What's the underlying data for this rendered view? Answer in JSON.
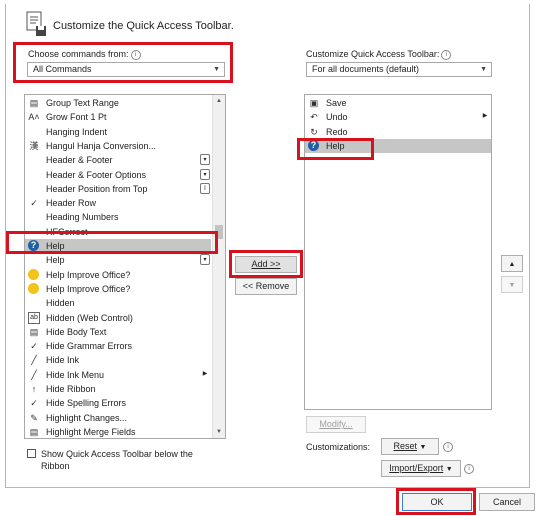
{
  "header": {
    "title": "Customize the Quick Access Toolbar."
  },
  "left": {
    "choose_label": "Choose commands from:",
    "choose_value": "All Commands",
    "items": [
      {
        "label": "Group Text Range",
        "icon": "group-text-icon",
        "glyph": "▤"
      },
      {
        "label": "Grow Font 1 Pt",
        "icon": "grow-font-icon",
        "glyph": "A˄"
      },
      {
        "label": "Hanging Indent",
        "icon": "",
        "glyph": ""
      },
      {
        "label": "Hangul Hanja Conversion...",
        "icon": "hanja-icon",
        "glyph": "漢"
      },
      {
        "label": "Header & Footer",
        "icon": "",
        "glyph": "",
        "side": "▾"
      },
      {
        "label": "Header & Footer Options",
        "icon": "",
        "glyph": "",
        "side": "▾"
      },
      {
        "label": "Header Position from Top",
        "icon": "",
        "glyph": "",
        "side": "I"
      },
      {
        "label": "Header Row",
        "icon": "check-icon",
        "glyph": "✓"
      },
      {
        "label": "Heading Numbers",
        "icon": "",
        "glyph": ""
      },
      {
        "label": "HFCorrect",
        "icon": "",
        "glyph": ""
      },
      {
        "label": "Help",
        "icon": "help-icon",
        "glyph": "?",
        "selected": true
      },
      {
        "label": "Help",
        "icon": "",
        "glyph": "",
        "side": "▾"
      },
      {
        "label": "Help Improve Office?",
        "icon": "smiley-icon",
        "glyph": "smile"
      },
      {
        "label": "Help Improve Office?",
        "icon": "smiley-icon",
        "glyph": "smile"
      },
      {
        "label": "Hidden",
        "icon": "",
        "glyph": ""
      },
      {
        "label": "Hidden (Web Control)",
        "icon": "ab-icon",
        "glyph": "ab"
      },
      {
        "label": "Hide Body Text",
        "icon": "body-text-icon",
        "glyph": "▤"
      },
      {
        "label": "Hide Grammar Errors",
        "icon": "check-icon",
        "glyph": "✓"
      },
      {
        "label": "Hide Ink",
        "icon": "ink-icon",
        "glyph": "╱"
      },
      {
        "label": "Hide Ink Menu",
        "icon": "ink-icon",
        "glyph": "╱",
        "side": "▶"
      },
      {
        "label": "Hide Ribbon",
        "icon": "ribbon-icon",
        "glyph": "↑"
      },
      {
        "label": "Hide Spelling Errors",
        "icon": "check-icon",
        "glyph": "✓"
      },
      {
        "label": "Highlight Changes...",
        "icon": "highlight-icon",
        "glyph": "✎"
      },
      {
        "label": "Highlight Merge Fields",
        "icon": "merge-fields-icon",
        "glyph": "▤"
      }
    ],
    "show_below_label": "Show Quick Access Toolbar below the",
    "show_below_label_2": "Ribbon"
  },
  "middle": {
    "add_label": "Add >>",
    "remove_label": "<< Remove"
  },
  "right": {
    "customize_label": "Customize Quick Access Toolbar:",
    "customize_value": "For all documents (default)",
    "items": [
      {
        "label": "Save",
        "icon": "save-icon",
        "glyph": "▣"
      },
      {
        "label": "Undo",
        "icon": "undo-icon",
        "glyph": "↶",
        "side": "▶"
      },
      {
        "label": "Redo",
        "icon": "redo-icon",
        "glyph": "↻"
      },
      {
        "label": "Help",
        "icon": "help-icon",
        "glyph": "?",
        "selected": true
      }
    ],
    "modify_label": "Modify...",
    "customizations_label": "Customizations:",
    "reset_label": "Reset",
    "import_export_label": "Import/Export"
  },
  "footer": {
    "ok_label": "OK",
    "cancel_label": "Cancel"
  },
  "colors": {
    "highlight": "#d7121e",
    "selected_row": "#c6c6c6",
    "help_icon": "#1f5fa8"
  }
}
